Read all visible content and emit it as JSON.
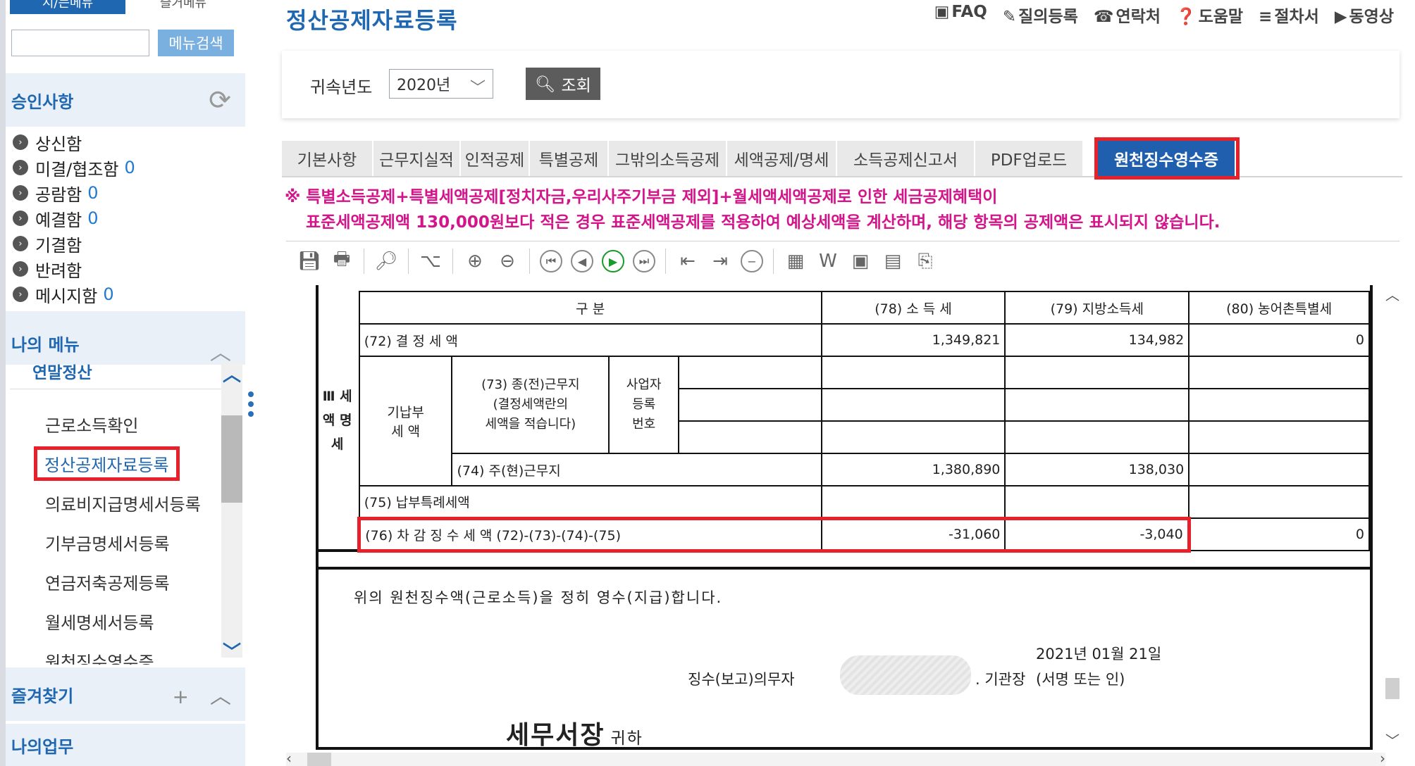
{
  "sidebar": {
    "top_tabs": [
      "시/는메뉴",
      "즐거메뉴"
    ],
    "search": {
      "value": "",
      "button": "메뉴검색"
    },
    "approval": {
      "title": "승인사항",
      "items": [
        {
          "label": "상신함",
          "count": ""
        },
        {
          "label": "미결/협조함",
          "count": "0"
        },
        {
          "label": "공람함",
          "count": "0"
        },
        {
          "label": "예결함",
          "count": "0"
        },
        {
          "label": "기결함",
          "count": ""
        },
        {
          "label": "반려함",
          "count": ""
        },
        {
          "label": "메시지함",
          "count": "0"
        }
      ]
    },
    "my_menu": {
      "title": "나의 메뉴",
      "group": "연말정산",
      "items": [
        "근로소득확인",
        "정산공제자료등록",
        "의료비지급명세서등록",
        "기부금명세서등록",
        "연금저축공제등록",
        "월세명세서등록",
        "원천징수영수증"
      ],
      "active_index": 1
    },
    "favorites": {
      "title": "즐겨찾기"
    },
    "my_work": {
      "title": "나의업무"
    }
  },
  "main": {
    "title": "정산공제자료등록",
    "links": [
      {
        "icon": "faq-icon",
        "glyph": "▣",
        "label": "FAQ"
      },
      {
        "icon": "pencil-icon",
        "glyph": "✎",
        "label": "질의등록"
      },
      {
        "icon": "phone-icon",
        "glyph": "☎",
        "label": "연락처"
      },
      {
        "icon": "help-icon",
        "glyph": "❓",
        "label": "도움말"
      },
      {
        "icon": "list-icon",
        "glyph": "≡",
        "label": "절차서"
      },
      {
        "icon": "play-icon",
        "glyph": "▶",
        "label": "동영상"
      }
    ],
    "filter": {
      "label": "귀속년도",
      "year": "2020년",
      "query_button": "조회"
    },
    "tabs": [
      "기본사항",
      "근무지실적",
      "인적공제",
      "특별공제",
      "그밖의소득공제",
      "세액공제/명세",
      "소득공제신고서",
      "PDF업로드",
      "원천징수영수증"
    ],
    "active_tab": 8,
    "notice": [
      "※ 특별소득공제+특별세액공제[정치자금,우리사주기부금 제외]+월세액세액공제로 인한 세금공제혜택이",
      "표준세액공제액 130,000원보다 적은 경우 표준세액공제를 적용하여 예상세액을 계산하며, 해당 항목의 공제액은 표시되지 않습니다."
    ]
  },
  "receipt_doc": {
    "section_label": "Ⅲ 세 액 명 세",
    "header": {
      "category": "구      분",
      "col78": "(78) 소  득  세",
      "col79": "(79) 지방소득세",
      "col80": "(80) 농어촌특별세"
    },
    "row72": {
      "label": "(72) 결   정   세   액",
      "v78": "1,349,821",
      "v79": "134,982",
      "v80": "0"
    },
    "prepaid": {
      "label": "기납부\n세 액",
      "row73_label": "(73) 종(전)근무지\n(결정세액란의\n세액을 적습니다)",
      "biz_no_label": "사업자\n등록\n번호"
    },
    "row74": {
      "label": "(74) 주(현)근무지",
      "v78": "1,380,890",
      "v79": "138,030",
      "v80": ""
    },
    "row75": {
      "label": "(75) 납부특례세액"
    },
    "row76": {
      "label": "(76) 차 감 징 수 세 액 (72)-(73)-(74)-(75)",
      "v78": "-31,060",
      "v79": "-3,040",
      "v80": "0"
    },
    "confirm_text": "위의 원천징수액(근로소득)을 정히 영수(지급)합니다.",
    "date": "2021년 01월 21일",
    "collector_label": "징수(보고)의무자",
    "org_head": "기관장",
    "sign_label": "(서명 또는 인)",
    "tax_office": "세무서장",
    "honorific": "귀하"
  },
  "colors": {
    "accent": "#1f67b0",
    "highlight_border": "#e8202a",
    "notice": "#d4148a",
    "active_tab": "#1f5fae"
  }
}
